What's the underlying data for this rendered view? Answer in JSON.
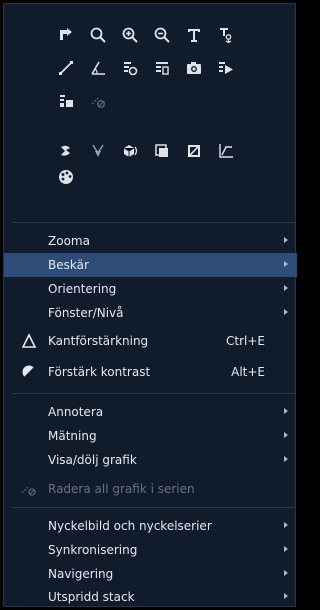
{
  "toolbar": {
    "row1": [
      "pan-icon",
      "magnifier-icon",
      "zoom-in-icon",
      "zoom-out-icon",
      "text-icon",
      "anchor-text-icon"
    ],
    "row2": [
      "line-icon",
      "angle-icon",
      "ruler-icon",
      "grid-icon",
      "camera-icon",
      "play-icon"
    ],
    "row3": [
      "layers-icon",
      "eraser-icon"
    ],
    "row4": [
      "tool-icon",
      "spotlight-icon",
      "cube-icon",
      "stack-icon",
      "display-icon",
      "curve-icon"
    ],
    "row5": [
      "palette-icon"
    ]
  },
  "menu": {
    "zoom": "Zooma",
    "crop": "Beskär",
    "orientation": "Orientering",
    "window_level": "Fönster/Nivå",
    "edge_enhancement": "Kantförstärkning",
    "edge_enhancement_shortcut": "Ctrl+E",
    "enhance_contrast": "Förstärk kontrast",
    "enhance_contrast_shortcut": "Alt+E",
    "annotate": "Annotera",
    "measurement": "Mätning",
    "show_hide_graphics": "Visa/dölj grafik",
    "clear_graphics": "Radera all grafik i serien",
    "key_image": "Nyckelbild och nyckelserier",
    "synchronization": "Synkronisering",
    "navigation": "Navigering",
    "spread_stack": "Utspridd stack"
  },
  "colors": {
    "panel_bg": "#101b2c",
    "selected_bg": "#2d4c78",
    "text": "#e6e9ee",
    "disabled_text": "#6a7280"
  }
}
